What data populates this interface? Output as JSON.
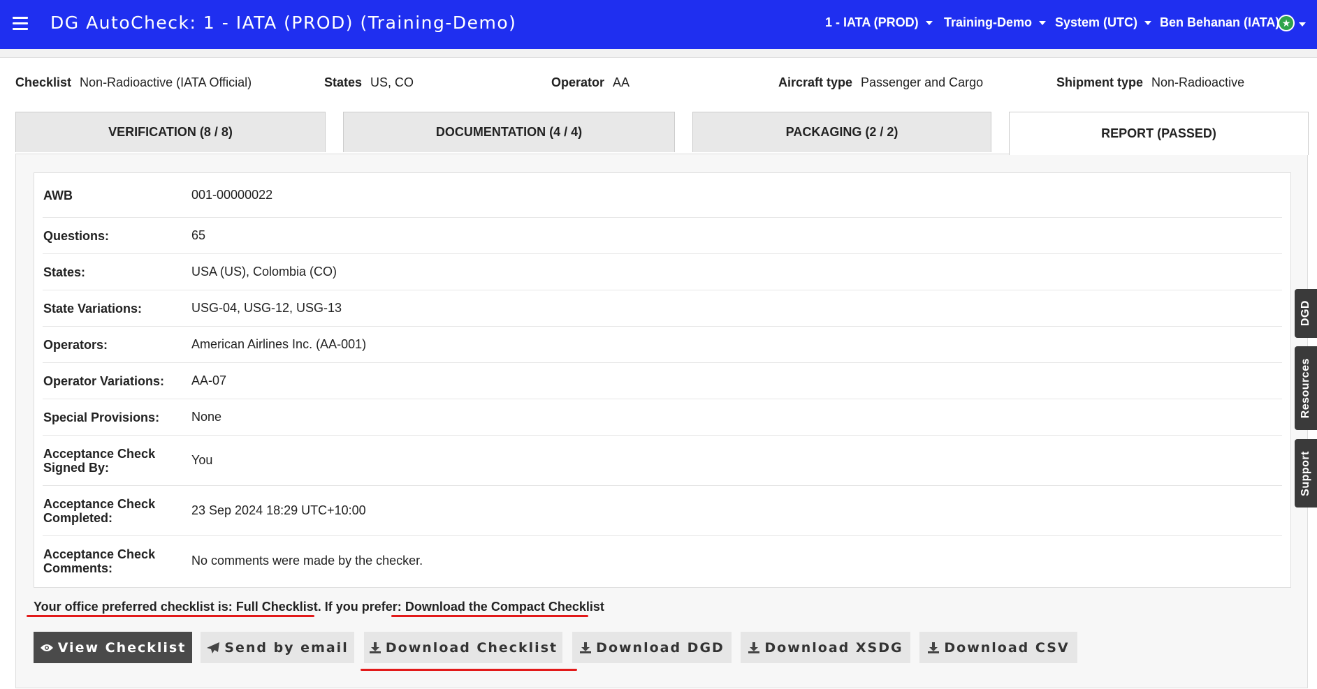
{
  "header": {
    "title": "DG AutoCheck: 1 - IATA (PROD) (Training-Demo)",
    "menus": [
      "1 - IATA (PROD)",
      "Training-Demo",
      "System (UTC)",
      "Ben Behanan (IATA)"
    ]
  },
  "meta": [
    {
      "label": "Checklist",
      "value": "Non-Radioactive (IATA Official)"
    },
    {
      "label": "States",
      "value": "US, CO"
    },
    {
      "label": "Operator",
      "value": "AA"
    },
    {
      "label": "Aircraft type",
      "value": "Passenger and Cargo"
    },
    {
      "label": "Shipment type",
      "value": "Non-Radioactive"
    }
  ],
  "tabs": [
    {
      "label": "VERIFICATION (8 / 8)"
    },
    {
      "label": "DOCUMENTATION (4 / 4)"
    },
    {
      "label": "PACKAGING (2 / 2)"
    },
    {
      "label": "REPORT (PASSED)",
      "active": true
    }
  ],
  "report": [
    {
      "label": "AWB",
      "value": "001-00000022"
    },
    {
      "label": "Questions:",
      "value": "65"
    },
    {
      "label": "States:",
      "value": "USA (US), Colombia (CO)"
    },
    {
      "label": "State Variations:",
      "value": "USG-04, USG-12, USG-13"
    },
    {
      "label": "Operators:",
      "value": "American Airlines Inc. (AA-001)"
    },
    {
      "label": "Operator Variations:",
      "value": "AA-07"
    },
    {
      "label": "Special Provisions:",
      "value": "None"
    },
    {
      "label": "Acceptance Check Signed By:",
      "value": "You"
    },
    {
      "label": "Acceptance Check Completed:",
      "value": "23 Sep 2024 18:29 UTC+10:00"
    },
    {
      "label": "Acceptance Check Comments:",
      "value": "No comments were made by the checker."
    }
  ],
  "preference": {
    "text": "Your office preferred checklist is: Full Checklist. If you prefer:",
    "link": "Download the Compact Checklist"
  },
  "buttons": {
    "view_checklist": "View Checklist",
    "send_email": "Send by email",
    "download_checklist": "Download Checklist",
    "download_dgd": "Download DGD",
    "download_xsdg": "Download XSDG",
    "download_csv": "Download CSV"
  },
  "side_tabs": [
    "DGD",
    "Resources",
    "Support"
  ],
  "colors": {
    "topbar": "#1f2ff0",
    "annotation": "#e21a1a",
    "avatar": "#2fa34a"
  }
}
